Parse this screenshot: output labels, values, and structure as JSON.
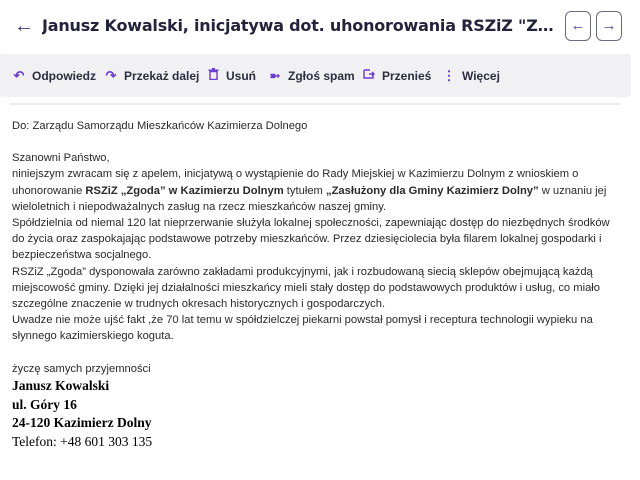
{
  "header": {
    "title": "Janusz Kowalski, inicjatywa dot. uhonorowania RSZiZ \"Zgoda\" w Kazimierzu Dolnym"
  },
  "toolbar": {
    "reply": "Odpowiedz",
    "forward": "Przekaż dalej",
    "delete": "Usuń",
    "spam": "Zgłoś spam",
    "move": "Przenieś",
    "more": "Więcej"
  },
  "message": {
    "to": "Do: Zarządu Samorządu Mieszkańców Kazimierza Dolnego",
    "greeting": "Szanowni Państwo,",
    "p1_a": "niniejszym zwracam się z apelem, inicjatywą  o wystąpienie do Rady Miejskiej w Kazimierzu Dolnym z wnioskiem o uhonorowanie ",
    "p1_b": "RSZiZ „Zgoda” w Kazimierzu Dolnym",
    "p1_c": " tytułem ",
    "p1_d": "„Zasłużony dla Gminy Kazimierz Dolny”",
    "p1_e": " w uznaniu jej wieloletnich i niepodważalnych zasług na rzecz mieszkańców naszej gminy.",
    "p2": "Spółdzielnia od niemal 120 lat nieprzerwanie służyła lokalnej społeczności, zapewniając dostęp do niezbędnych środków do życia oraz zaspokajając podstawowe potrzeby mieszkańców. Przez dziesięciolecia była filarem lokalnej gospodarki i bezpieczeństwa socjalnego.",
    "p3": "RSZiZ „Zgoda” dysponowała zarówno zakładami produkcyjnymi, jak i rozbudowaną siecią sklepów obejmującą każdą miejscowość gminy. Dzięki jej działalności mieszkańcy mieli stały dostęp do podstawowych produktów i usług, co miało szczególne znaczenie w trudnych okresach historycznych i gospodarczych.",
    "p4": "Uwadze nie może ujść fakt ,że 70 lat temu w spółdzielczej  piekarni powstał pomysł i receptura technologii wypieku na słynnego kazimierskiego koguta.",
    "closing": "życzę samych przyjemności",
    "sig_name": "Janusz Kowalski",
    "sig_street": "ul. Góry 16",
    "sig_city": "24-120 Kazimierz Dolny",
    "sig_phone": "Telefon: +48 601 303 135"
  }
}
